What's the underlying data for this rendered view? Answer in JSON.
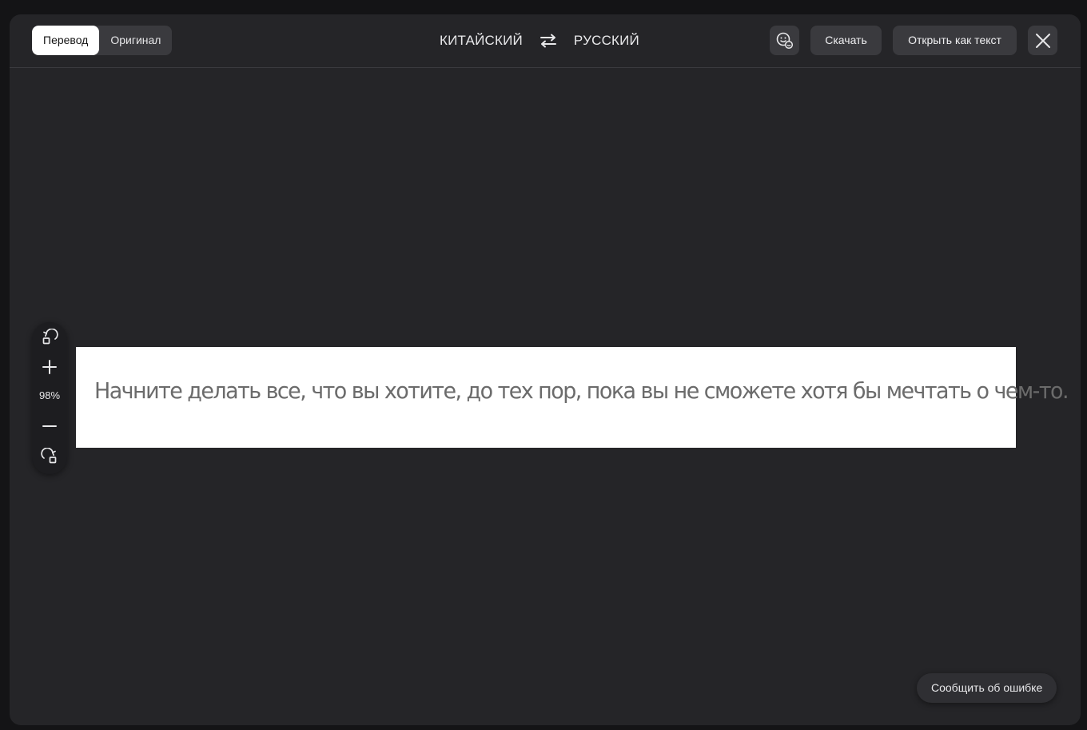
{
  "header": {
    "view_tabs": [
      {
        "label": "Перевод",
        "active": true
      },
      {
        "label": "Оригинал",
        "active": false
      }
    ],
    "source_language": "КИТАЙСКИЙ",
    "target_language": "РУССКИЙ",
    "download_label": "Скачать",
    "open_as_text_label": "Открыть как текст"
  },
  "zoom": {
    "level": "98%"
  },
  "document": {
    "text": "Начните делать все, что вы хотите, до тех пор, пока вы не сможете хотя бы мечтать о чем-то."
  },
  "footer": {
    "report_error_label": "Сообщить об ошибке"
  },
  "icons": {
    "swap": "swap-arrows-icon",
    "feedback": "smile-feedback-icon",
    "close": "close-icon",
    "rotate_left": "rotate-left-icon",
    "zoom_in": "plus-icon",
    "zoom_out": "minus-icon",
    "rotate_right": "rotate-right-icon"
  },
  "colors": {
    "background": "#141416",
    "panel": "#252528",
    "button": "#3a3a3e",
    "active_tab": "#ffffff",
    "document_text": "#6b6b6b"
  }
}
